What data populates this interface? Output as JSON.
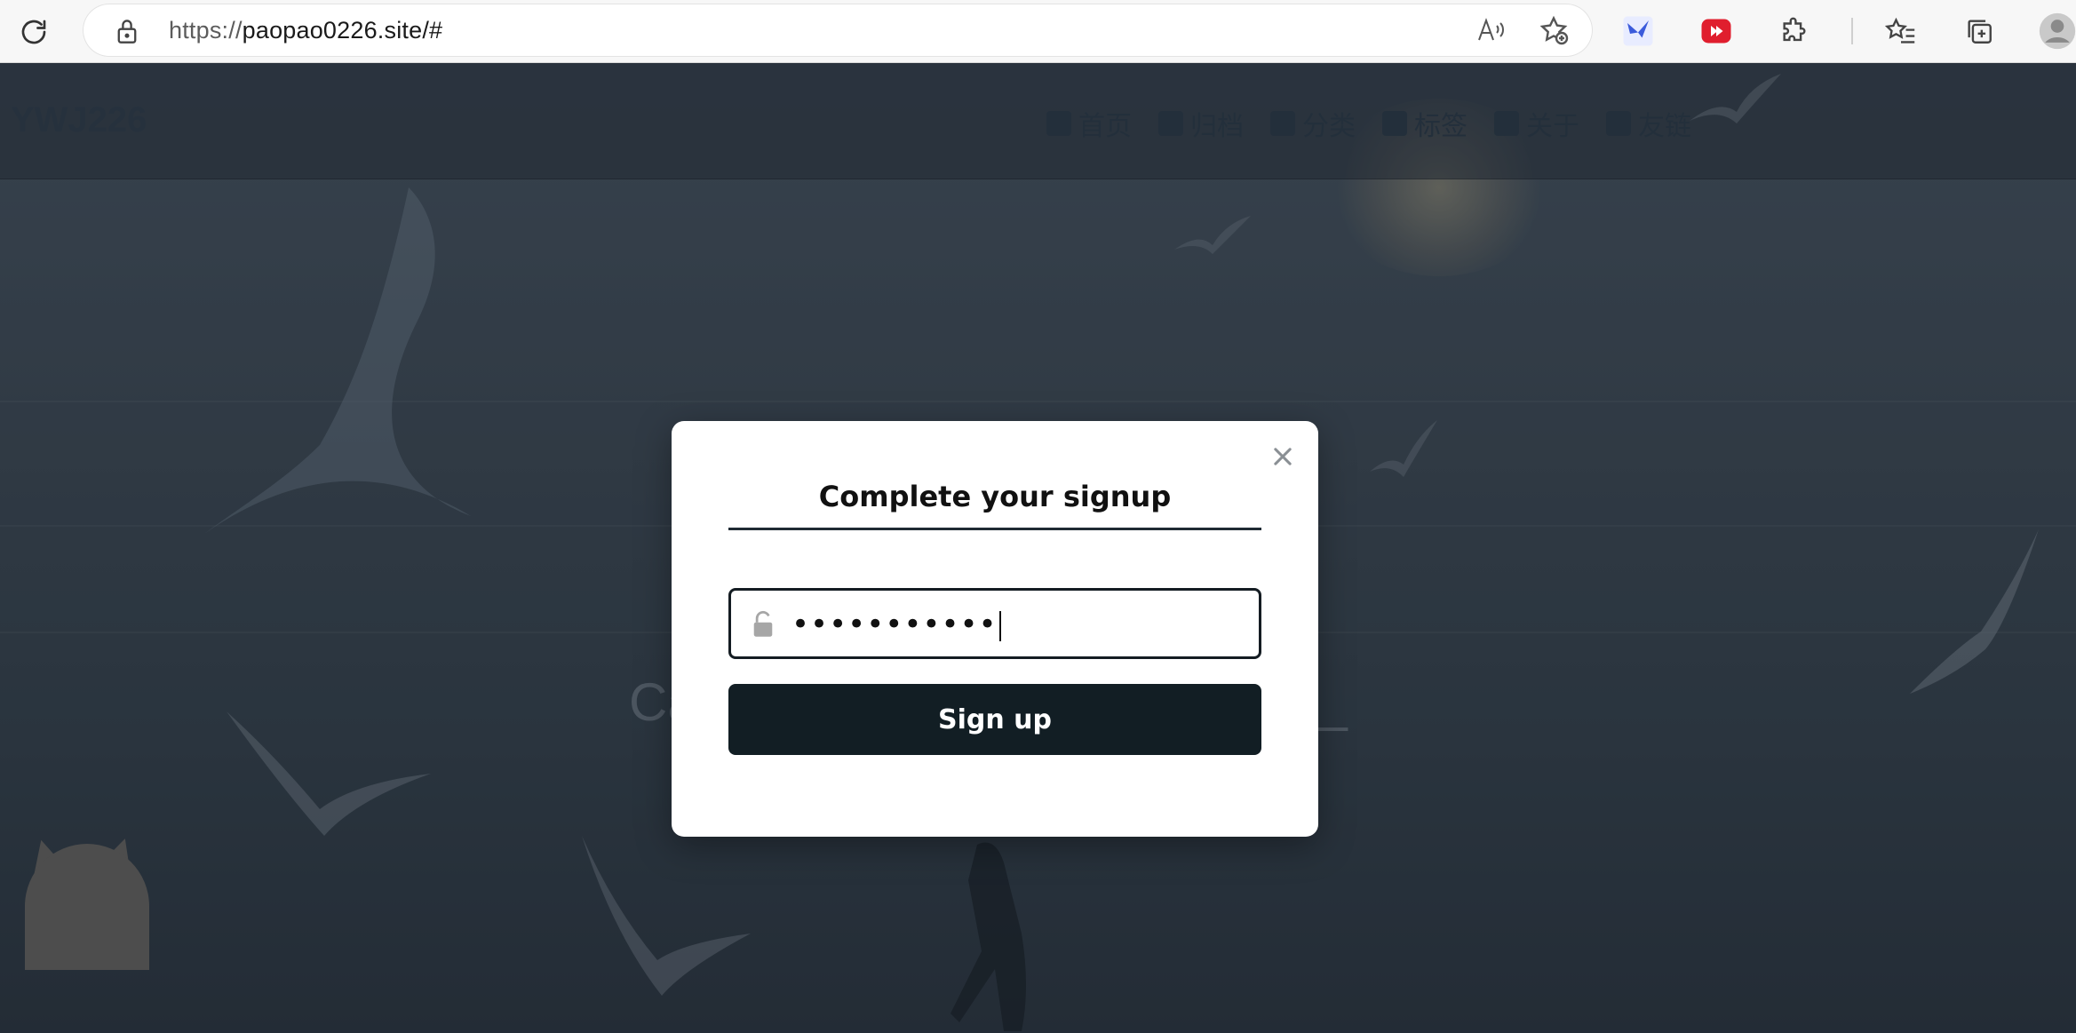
{
  "browser": {
    "url_protocol": "https://",
    "url_host": "paopao0226.site/#",
    "icons": [
      "reload-icon",
      "lock-icon",
      "read-aloud-icon",
      "add-favorite-icon",
      "extension-blue-bird-icon",
      "extension-video-icon",
      "extensions-icon",
      "favorites-icon",
      "collections-icon",
      "profile-icon"
    ]
  },
  "site": {
    "title": "YWJ226",
    "nav": [
      "首页",
      "归档",
      "分类",
      "标签",
      "关于",
      "友链"
    ],
    "hero_text": "Ca",
    "hero_cursor": "l_"
  },
  "modal": {
    "title": "Complete your signup",
    "password_value": "•••••••••••",
    "signup_label": "Sign up",
    "close_symbol": "✕"
  },
  "colors": {
    "modal_button": "#121e24",
    "title_underline": "#1f2a33"
  }
}
